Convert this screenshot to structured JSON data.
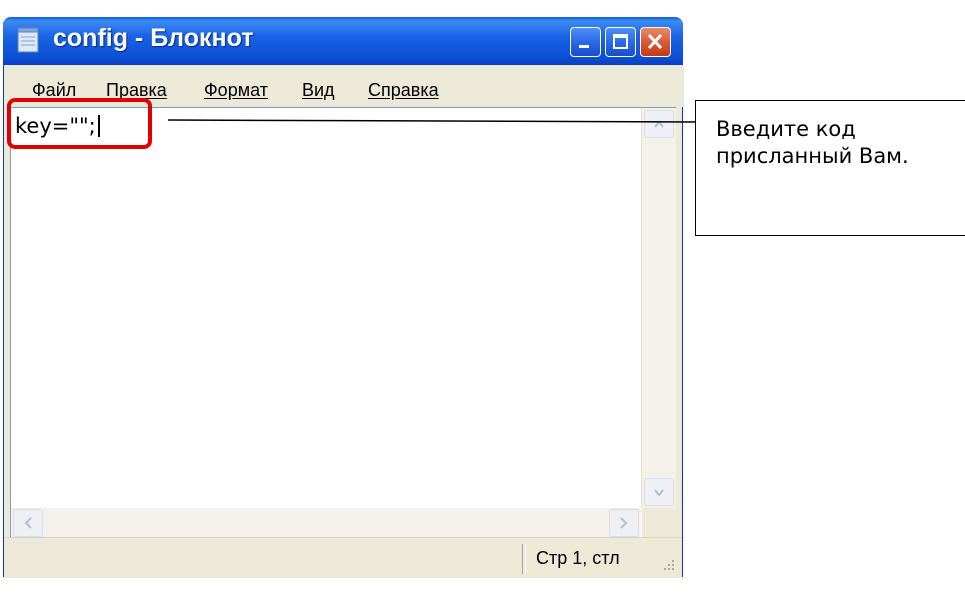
{
  "window": {
    "title": "config - Блокнот",
    "title_color": "#0a4fd4",
    "close_color": "#d6532f"
  },
  "menu": {
    "items": [
      {
        "label": "Файл"
      },
      {
        "label": "Правка"
      },
      {
        "label": "Формат"
      },
      {
        "label": "Вид"
      },
      {
        "label": "Справка"
      }
    ]
  },
  "editor": {
    "text": "key=\"\";"
  },
  "status": {
    "position": "Стр 1, стл"
  },
  "annotation": {
    "text": "Введите код присланный Вам.",
    "highlight_color": "#e00000"
  },
  "icons": {
    "app": "notepad-icon",
    "minimize": "minimize-icon",
    "maximize": "maximize-icon",
    "close": "close-icon"
  }
}
